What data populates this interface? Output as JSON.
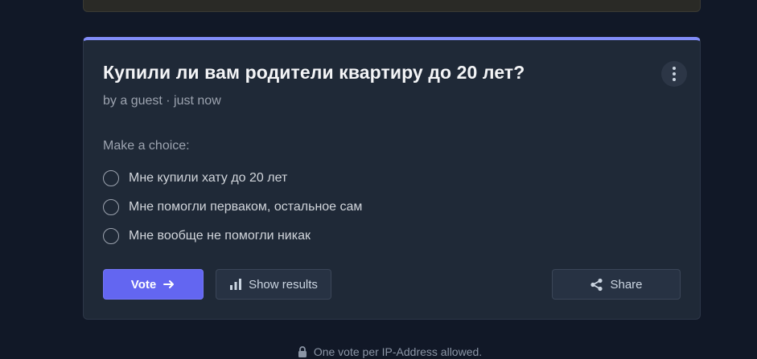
{
  "poll": {
    "title": "Купили ли вам родители квартиру до 20 лет?",
    "meta": "by a guest · just now",
    "prompt": "Make a choice:",
    "options": [
      {
        "label": "Мне купили хату до 20 лет"
      },
      {
        "label": "Мне помогли перваком, остальное сам"
      },
      {
        "label": "Мне вообще не помогли никак"
      }
    ]
  },
  "actions": {
    "vote_label": "Vote",
    "results_label": "Show results",
    "share_label": "Share"
  },
  "footer": {
    "notice": "One vote per IP-Address allowed."
  },
  "colors": {
    "accent": "#6366f1",
    "card_top_border": "#818cf8",
    "background": "#111827",
    "card": "#1f2937"
  },
  "icons": [
    "more-vertical-icon",
    "arrow-right-icon",
    "bar-chart-icon",
    "share-icon",
    "lock-icon"
  ]
}
